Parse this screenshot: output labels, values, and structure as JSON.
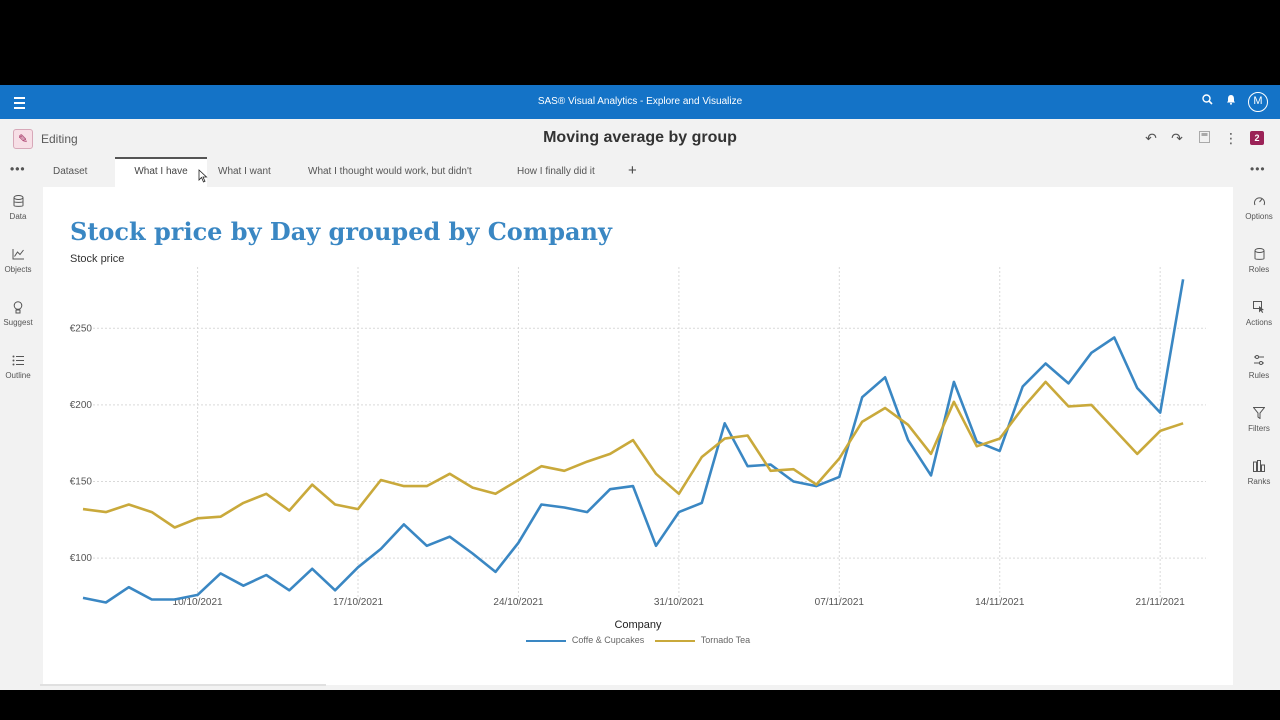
{
  "app": {
    "title": "SAS® Visual Analytics - Explore and Visualize",
    "user_initial": "M"
  },
  "editbar": {
    "mode_label": "Editing",
    "report_title": "Moving average by group",
    "badge_count": "2"
  },
  "tabs": [
    {
      "label": "Dataset"
    },
    {
      "label": "What I have"
    },
    {
      "label": "What I want"
    },
    {
      "label": "What I thought would work, but didn't"
    },
    {
      "label": "How I finally did it"
    }
  ],
  "left_pane": [
    {
      "label": "Data",
      "icon": "data-icon"
    },
    {
      "label": "Objects",
      "icon": "objects-icon"
    },
    {
      "label": "Suggest",
      "icon": "suggest-icon"
    },
    {
      "label": "Outline",
      "icon": "outline-icon"
    }
  ],
  "right_pane": [
    {
      "label": "Options",
      "icon": "options-icon"
    },
    {
      "label": "Roles",
      "icon": "roles-icon"
    },
    {
      "label": "Actions",
      "icon": "actions-icon"
    },
    {
      "label": "Rules",
      "icon": "rules-icon"
    },
    {
      "label": "Filters",
      "icon": "filters-icon"
    },
    {
      "label": "Ranks",
      "icon": "ranks-icon"
    }
  ],
  "colors": {
    "topbar": "#1473c7",
    "accent": "#9b2257",
    "series1": "#3a87c3",
    "series2": "#c9a93b"
  },
  "chart_data": {
    "type": "line",
    "title": "Stock price by Day grouped by Company",
    "ylabel": "Stock price",
    "legend_title": "Company",
    "x_start": "2021-10-05",
    "x_end": "2021-11-23",
    "x_ticks": [
      "10/10/2021",
      "17/10/2021",
      "24/10/2021",
      "31/10/2021",
      "07/11/2021",
      "14/11/2021",
      "21/11/2021"
    ],
    "y_ticks": [
      "€100",
      "€150",
      "€200",
      "€250"
    ],
    "y_tick_values": [
      100,
      150,
      200,
      250
    ],
    "ylim": [
      72,
      290
    ],
    "grid": true,
    "series": [
      {
        "name": "Coffe & Cupcakes",
        "color": "#3a87c3",
        "values": [
          74,
          71,
          81,
          73,
          73,
          76,
          90,
          82,
          89,
          79,
          93,
          79,
          94,
          106,
          122,
          108,
          114,
          103,
          91,
          110,
          135,
          133,
          130,
          145,
          147,
          108,
          130,
          136,
          188,
          160,
          161,
          150,
          147,
          153,
          205,
          218,
          177,
          154,
          215,
          176,
          170,
          212,
          227,
          214,
          234,
          244,
          211,
          195,
          282
        ]
      },
      {
        "name": "Tornado Tea",
        "color": "#c9a93b",
        "values": [
          132,
          130,
          135,
          130,
          120,
          126,
          127,
          136,
          142,
          131,
          148,
          135,
          132,
          151,
          147,
          147,
          155,
          146,
          142,
          151,
          160,
          157,
          163,
          168,
          177,
          155,
          142,
          166,
          178,
          180,
          157,
          158,
          148,
          165,
          189,
          198,
          187,
          168,
          202,
          173,
          178,
          198,
          215,
          199,
          200,
          184,
          168,
          183,
          188
        ]
      }
    ]
  }
}
